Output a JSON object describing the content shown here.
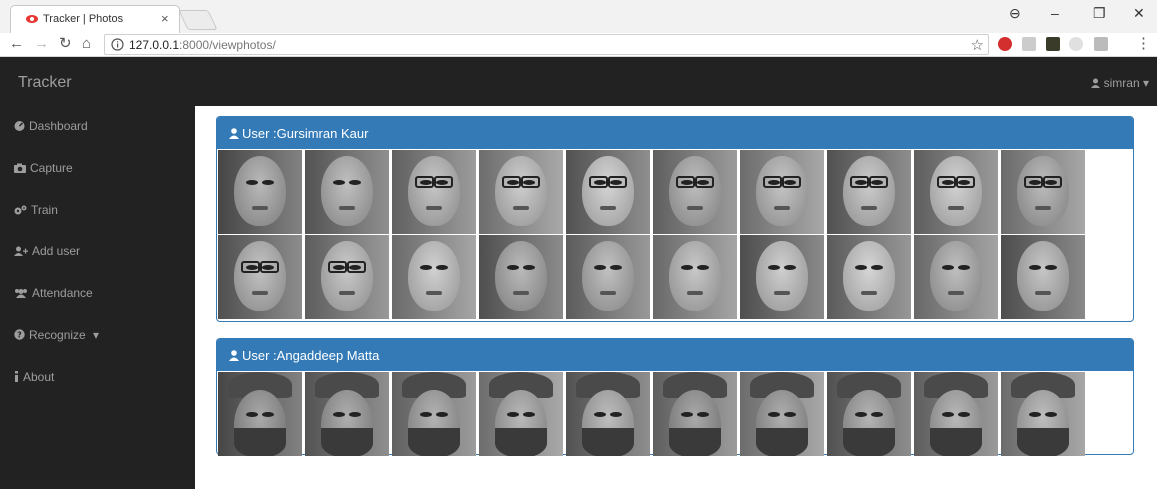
{
  "browser": {
    "tab_title": "Tracker | Photos",
    "tab_close": "×",
    "url_host": "127.0.0.1",
    "url_path": ":8000/viewphotos/",
    "window_controls": {
      "profile": "⊖",
      "minimize": "–",
      "restore": "❐",
      "close": "✕"
    }
  },
  "navbar": {
    "brand": "Tracker",
    "user": "simran"
  },
  "sidebar": {
    "items": [
      {
        "label": "Dashboard",
        "icon": "tachometer-icon"
      },
      {
        "label": "Capture",
        "icon": "camera-icon"
      },
      {
        "label": "Train",
        "icon": "gears-icon"
      },
      {
        "label": "Add user",
        "icon": "user-plus-icon"
      },
      {
        "label": "Attendance",
        "icon": "users-icon"
      },
      {
        "label": "Recognize",
        "icon": "question-circle-icon",
        "dropdown": true
      },
      {
        "label": "About",
        "icon": "info-icon"
      }
    ]
  },
  "panels": [
    {
      "title": "User :Gursimran Kaur",
      "photos": 20
    },
    {
      "title": "User :Angaddeep Matta",
      "photos": 10
    }
  ],
  "colors": {
    "navbar_bg": "#222222",
    "sidebar_bg": "#222222",
    "panel_primary": "#337ab7",
    "sidebar_text": "#9d9d9d"
  }
}
